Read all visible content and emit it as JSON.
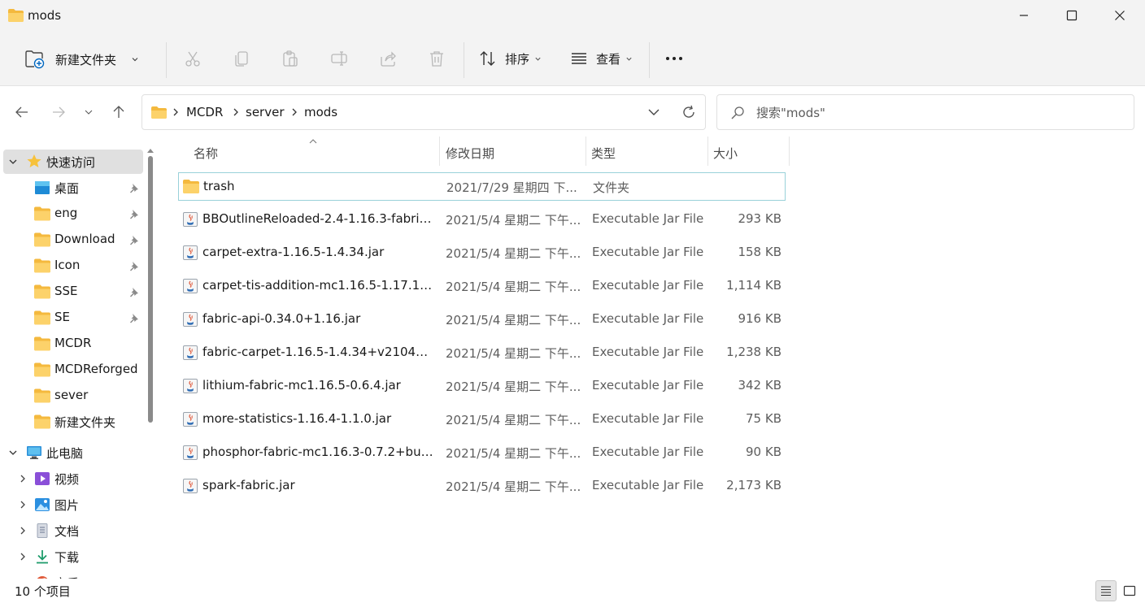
{
  "window": {
    "title": "mods"
  },
  "toolbar": {
    "new_folder_label": "新建文件夹",
    "sort_label": "排序",
    "view_label": "查看",
    "more_label": "···"
  },
  "address": {
    "crumbs": [
      "MCDR",
      "server",
      "mods"
    ]
  },
  "search": {
    "placeholder": "搜索\"mods\""
  },
  "sidebar": {
    "quick_access": {
      "label": "快速访问",
      "items": [
        {
          "label": "桌面",
          "icon": "desktop-icon",
          "pinned": true
        },
        {
          "label": "eng",
          "icon": "folder-icon",
          "pinned": true
        },
        {
          "label": "Download",
          "icon": "folder-icon",
          "pinned": true
        },
        {
          "label": "Icon",
          "icon": "folder-icon",
          "pinned": true
        },
        {
          "label": "SSE",
          "icon": "folder-icon",
          "pinned": true
        },
        {
          "label": "SE",
          "icon": "folder-icon",
          "pinned": true
        },
        {
          "label": "MCDR",
          "icon": "folder-icon",
          "pinned": false
        },
        {
          "label": "MCDReforged",
          "icon": "folder-icon",
          "pinned": false
        },
        {
          "label": "sever",
          "icon": "folder-icon",
          "pinned": false
        },
        {
          "label": "新建文件夹",
          "icon": "folder-icon",
          "pinned": false
        }
      ]
    },
    "this_pc": {
      "label": "此电脑",
      "items": [
        {
          "label": "视频",
          "icon": "video-icon"
        },
        {
          "label": "图片",
          "icon": "pictures-icon"
        },
        {
          "label": "文档",
          "icon": "documents-icon"
        },
        {
          "label": "下载",
          "icon": "downloads-icon"
        },
        {
          "label": "音乐",
          "icon": "music-icon"
        }
      ]
    }
  },
  "columns": {
    "name": "名称",
    "date": "修改日期",
    "type": "类型",
    "size": "大小"
  },
  "files": [
    {
      "name": "trash",
      "date": "2021/7/29 星期四 下...",
      "type": "文件夹",
      "size": "",
      "kind": "folder"
    },
    {
      "name": "BBOutlineReloaded-2.4-1.16.3-fabric....",
      "date": "2021/5/4 星期二 下午...",
      "type": "Executable Jar File",
      "size": "293 KB",
      "kind": "jar"
    },
    {
      "name": "carpet-extra-1.16.5-1.4.34.jar",
      "date": "2021/5/4 星期二 下午...",
      "type": "Executable Jar File",
      "size": "158 KB",
      "kind": "jar"
    },
    {
      "name": "carpet-tis-addition-mc1.16.5-1.17.1+...",
      "date": "2021/5/4 星期二 下午...",
      "type": "Executable Jar File",
      "size": "1,114 KB",
      "kind": "jar"
    },
    {
      "name": "fabric-api-0.34.0+1.16.jar",
      "date": "2021/5/4 星期二 下午...",
      "type": "Executable Jar File",
      "size": "916 KB",
      "kind": "jar"
    },
    {
      "name": "fabric-carpet-1.16.5-1.4.34+v210428...",
      "date": "2021/5/4 星期二 下午...",
      "type": "Executable Jar File",
      "size": "1,238 KB",
      "kind": "jar"
    },
    {
      "name": "lithium-fabric-mc1.16.5-0.6.4.jar",
      "date": "2021/5/4 星期二 下午...",
      "type": "Executable Jar File",
      "size": "342 KB",
      "kind": "jar"
    },
    {
      "name": "more-statistics-1.16.4-1.1.0.jar",
      "date": "2021/5/4 星期二 下午...",
      "type": "Executable Jar File",
      "size": "75 KB",
      "kind": "jar"
    },
    {
      "name": "phosphor-fabric-mc1.16.3-0.7.2+buil...",
      "date": "2021/5/4 星期二 下午...",
      "type": "Executable Jar File",
      "size": "90 KB",
      "kind": "jar"
    },
    {
      "name": "spark-fabric.jar",
      "date": "2021/5/4 星期二 下午...",
      "type": "Executable Jar File",
      "size": "2,173 KB",
      "kind": "jar"
    }
  ],
  "status": {
    "item_count": "10 个项目"
  },
  "colors": {
    "folder": "#f8c94a",
    "accent": "#0067c0",
    "selection_border": "#99d1d9"
  }
}
